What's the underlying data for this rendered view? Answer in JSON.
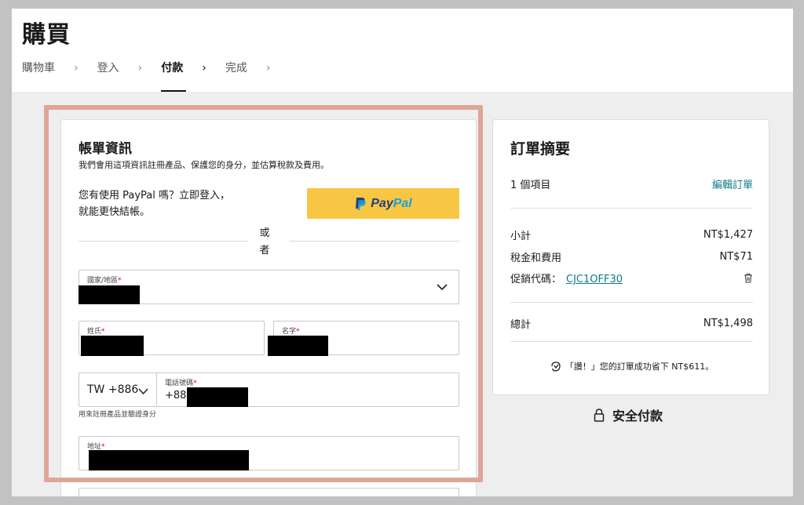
{
  "header": {
    "title": "購買",
    "steps": [
      {
        "label": "購物車"
      },
      {
        "label": "登入"
      },
      {
        "label": "付款"
      },
      {
        "label": "完成"
      }
    ]
  },
  "billing": {
    "title": "帳單資訊",
    "subtitle": "我們會用這項資訊註冊產品、保護您的身分，並估算稅款及費用。",
    "paypal_prompt": "您有使用 PayPal 嗎？立即登入，就能更快結帳。",
    "paypal_button_pay": "Pay",
    "paypal_button_pal": "Pal",
    "or_text": "或者",
    "country_label": "國家/地區",
    "last_name_label": "姓氏",
    "first_name_label": "名字",
    "dial_code": "TW +886",
    "phone_label": "電話號碼",
    "phone_prefix": "+886",
    "phone_helper": "用來註冊產品並驗證身分",
    "address_label": "地址",
    "required_mark": "*"
  },
  "summary": {
    "title": "訂單摘要",
    "items_count": "1 個項目",
    "edit_order": "編輯訂單",
    "subtotal_label": "小計",
    "subtotal_value": "NT$1,427",
    "tax_label": "稅金和費用",
    "tax_value": "NT$71",
    "promo_label": "促銷代碼：",
    "promo_code": "CJC1OFF30",
    "total_label": "總計",
    "total_value": "NT$1,498",
    "savings_text": "「讚！」您的訂單成功省下 NT$611。"
  },
  "secure_checkout": "安全付款",
  "colors": {
    "accent_link": "#0e7c86",
    "paypal_yellow": "#f7c744",
    "highlight_border": "#dfa597",
    "required": "#d0021b"
  }
}
